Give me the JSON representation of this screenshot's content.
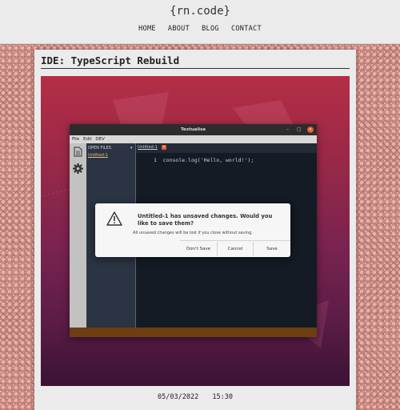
{
  "header": {
    "brand": "{rn.code}",
    "nav": [
      "HOME",
      "ABOUT",
      "BLOG",
      "CONTACT"
    ]
  },
  "post": {
    "title": "IDE: TypeScript Rebuild",
    "date": "05/03/2022",
    "time": "15:30"
  },
  "screenshot": {
    "window": {
      "title": "Textualise",
      "controls": [
        "–",
        "□",
        "×"
      ],
      "menu": [
        "File",
        "Edit",
        "DEV"
      ]
    },
    "sidebar": {
      "header": "OPEN FILES",
      "chevron": "▾",
      "files": [
        "Untitled-1"
      ]
    },
    "tab": {
      "label": "Untitled-1",
      "close": "×"
    },
    "editor": {
      "line_number": "1",
      "code": "console.log('Hello, world!');"
    },
    "dialog": {
      "title": "Untitled-1 has unsaved changes. Would you like to save them?",
      "message": "All unsaved changes will be lost if you close without saving.",
      "buttons": {
        "dont_save": "Don't Save",
        "cancel": "Cancel",
        "save": "Save"
      }
    }
  },
  "colors": {
    "desktop_top": "#b52e45",
    "desktop_bottom": "#3b1235",
    "accent_close": "#e05b2b",
    "statusbar": "#6e3d12",
    "editor_bg": "#141b24"
  }
}
